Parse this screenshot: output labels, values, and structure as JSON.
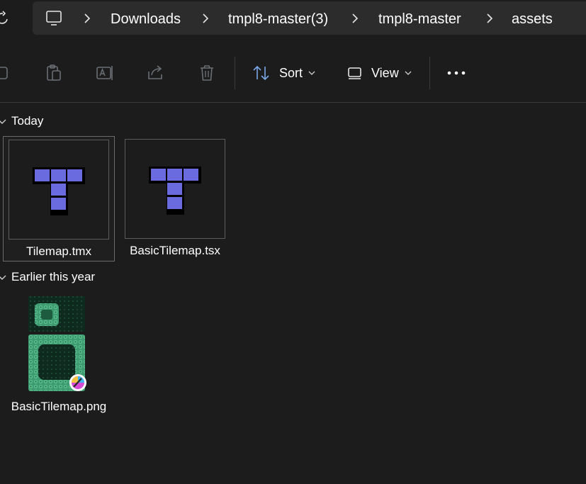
{
  "address_bar": {
    "breadcrumbs": [
      "Downloads",
      "tmpl8-master(3)",
      "tmpl8-master",
      "assets"
    ]
  },
  "toolbar": {
    "sort_label": "Sort",
    "view_label": "View"
  },
  "groups": [
    {
      "label": "Today"
    },
    {
      "label": "Earlier this year"
    }
  ],
  "files": [
    {
      "name": "Tilemap.tmx"
    },
    {
      "name": "BasicTilemap.tsx"
    },
    {
      "name": "BasicTilemap.png"
    }
  ],
  "colors": {
    "background": "#1c1c1c",
    "address_bar": "#2c2c2c",
    "tile_icon": "#6b6be0",
    "png_teal": "#3f9c72"
  }
}
